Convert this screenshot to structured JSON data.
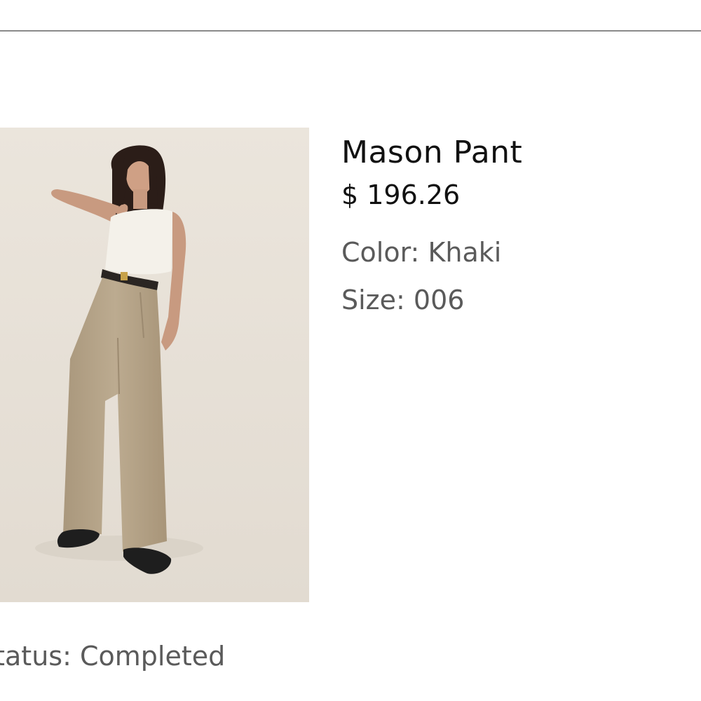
{
  "product": {
    "name": "Mason Pant",
    "price": "$ 196.26",
    "color_label": "Color:",
    "color_value": "Khaki",
    "size_label": "Size:",
    "size_value": "006"
  },
  "order": {
    "status_label": "Status:",
    "status_value": "Completed"
  },
  "colors": {
    "divider": "#8a8a8a",
    "image_bg": "#e6dfd5",
    "pants": "#b9a78c",
    "primary_text": "#111111",
    "secondary_text": "#5a5a5a"
  }
}
